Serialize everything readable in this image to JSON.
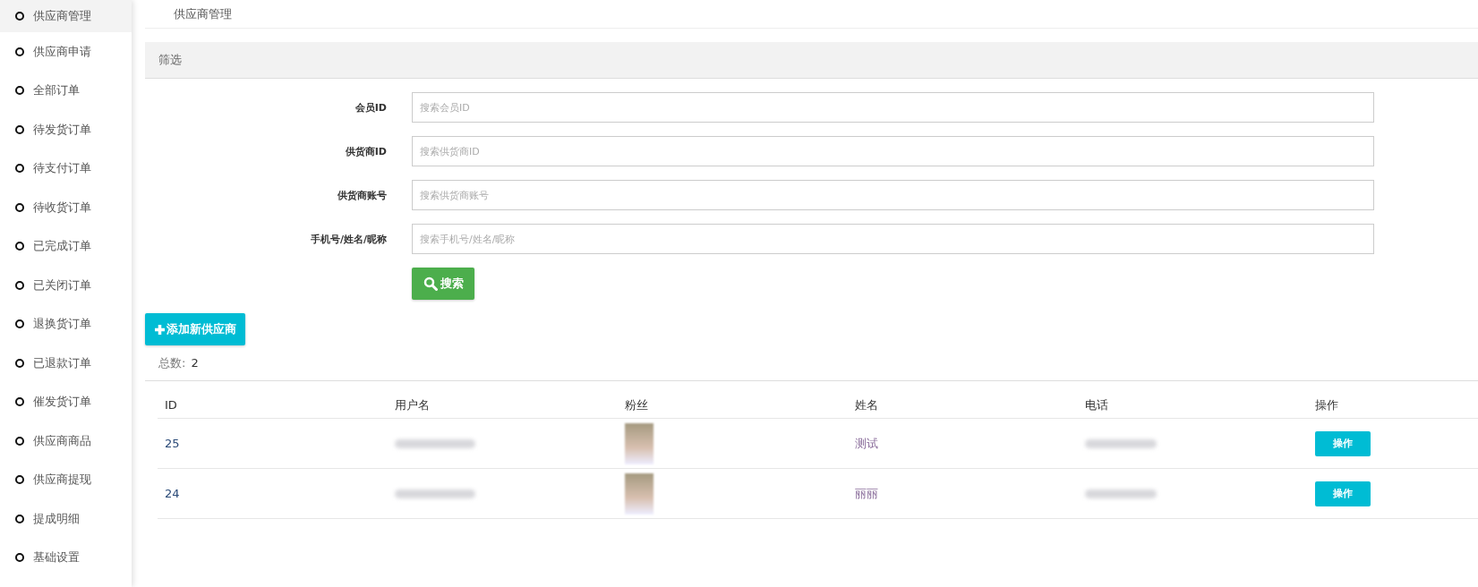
{
  "sidebar": {
    "items": [
      {
        "label": "供应商管理",
        "selected": true
      },
      {
        "label": "供应商申请",
        "selected": false
      },
      {
        "label": "全部订单",
        "selected": false
      },
      {
        "label": "待发货订单",
        "selected": false
      },
      {
        "label": "待支付订单",
        "selected": false
      },
      {
        "label": "待收货订单",
        "selected": false
      },
      {
        "label": "已完成订单",
        "selected": false
      },
      {
        "label": "已关闭订单",
        "selected": false
      },
      {
        "label": "退换货订单",
        "selected": false
      },
      {
        "label": "已退款订单",
        "selected": false
      },
      {
        "label": "催发货订单",
        "selected": false
      },
      {
        "label": "供应商商品",
        "selected": false
      },
      {
        "label": "供应商提现",
        "selected": false
      },
      {
        "label": "提成明细",
        "selected": false
      },
      {
        "label": "基础设置",
        "selected": false
      }
    ]
  },
  "page_title": "供应商管理",
  "filter": {
    "title": "筛选",
    "fields": [
      {
        "label": "会员ID",
        "placeholder": "搜索会员ID"
      },
      {
        "label": "供货商ID",
        "placeholder": "搜索供货商ID"
      },
      {
        "label": "供货商账号",
        "placeholder": "搜索供货商账号"
      },
      {
        "label": "手机号/姓名/昵称",
        "placeholder": "搜索手机号/姓名/昵称"
      }
    ],
    "search_button": "搜索"
  },
  "add_button": "添加新供应商",
  "total": {
    "label": "总数:",
    "value": "2"
  },
  "table": {
    "columns": [
      "ID",
      "用户名",
      "粉丝",
      "姓名",
      "电话",
      "操作"
    ],
    "rows": [
      {
        "id": "25",
        "name": "测试",
        "action": "操作"
      },
      {
        "id": "24",
        "name": "丽丽",
        "action": "操作"
      }
    ]
  }
}
